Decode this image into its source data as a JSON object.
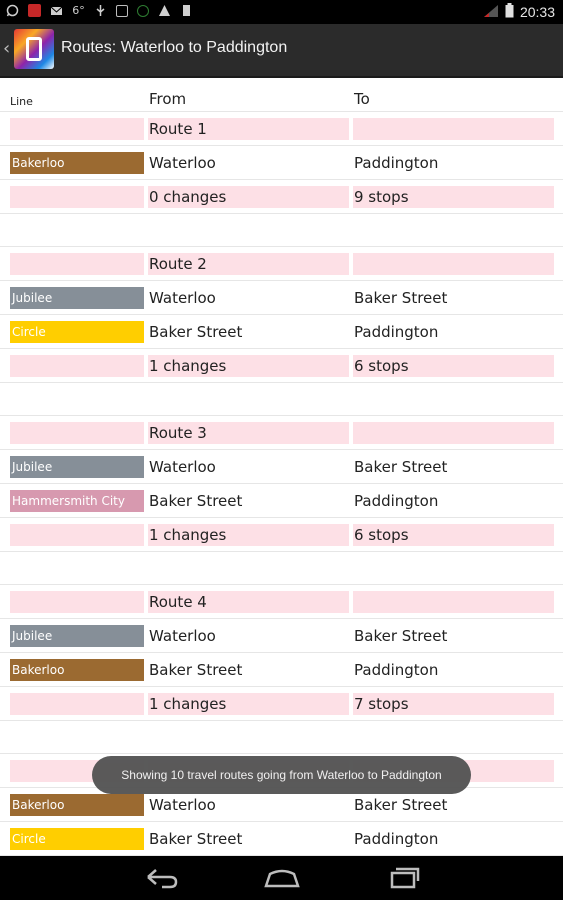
{
  "status_bar": {
    "time": "20:33",
    "left_icons": [
      "whatsapp-icon",
      "app-icon",
      "mail-icon",
      "6°",
      "usb-icon",
      "app-icon",
      "sync-icon",
      "warning-icon",
      "sdcard-icon"
    ]
  },
  "action_bar": {
    "title": "Routes: Waterloo to Paddington"
  },
  "table": {
    "headers": {
      "line": "Line",
      "from": "From",
      "to": "To"
    },
    "routes": [
      {
        "name": "Route 1",
        "legs": [
          {
            "line": "Bakerloo",
            "color": "#9b6a31",
            "from": "Waterloo",
            "to": "Paddington"
          }
        ],
        "changes": "0 changes",
        "stops": "9 stops"
      },
      {
        "name": "Route 2",
        "legs": [
          {
            "line": "Jubilee",
            "color": "#868f98",
            "from": "Waterloo",
            "to": "Baker Street"
          },
          {
            "line": "Circle",
            "color": "#ffce00",
            "from": "Baker Street",
            "to": "Paddington"
          }
        ],
        "changes": "1 changes",
        "stops": "6 stops"
      },
      {
        "name": "Route 3",
        "legs": [
          {
            "line": "Jubilee",
            "color": "#868f98",
            "from": "Waterloo",
            "to": "Baker Street"
          },
          {
            "line": "Hammersmith City",
            "color": "#d799af",
            "from": "Baker Street",
            "to": "Paddington"
          }
        ],
        "changes": "1 changes",
        "stops": "6 stops"
      },
      {
        "name": "Route 4",
        "legs": [
          {
            "line": "Jubilee",
            "color": "#868f98",
            "from": "Waterloo",
            "to": "Baker Street"
          },
          {
            "line": "Bakerloo",
            "color": "#9b6a31",
            "from": "Baker Street",
            "to": "Paddington"
          }
        ],
        "changes": "1 changes",
        "stops": "7 stops"
      },
      {
        "name": "",
        "legs": [
          {
            "line": "Bakerloo",
            "color": "#9b6a31",
            "from": "Waterloo",
            "to": "Baker Street"
          },
          {
            "line": "Circle",
            "color": "#ffce00",
            "from": "Baker Street",
            "to": "Paddington"
          }
        ],
        "changes": "",
        "stops": ""
      }
    ]
  },
  "toast": {
    "message": "Showing 10 travel routes going from Waterloo to Paddington"
  },
  "nav_bar": {
    "buttons": [
      "back-icon",
      "home-icon",
      "recents-icon"
    ]
  },
  "colors": {
    "route_row_bg": "#fde0e6",
    "action_bar": "#2b2b2b"
  }
}
